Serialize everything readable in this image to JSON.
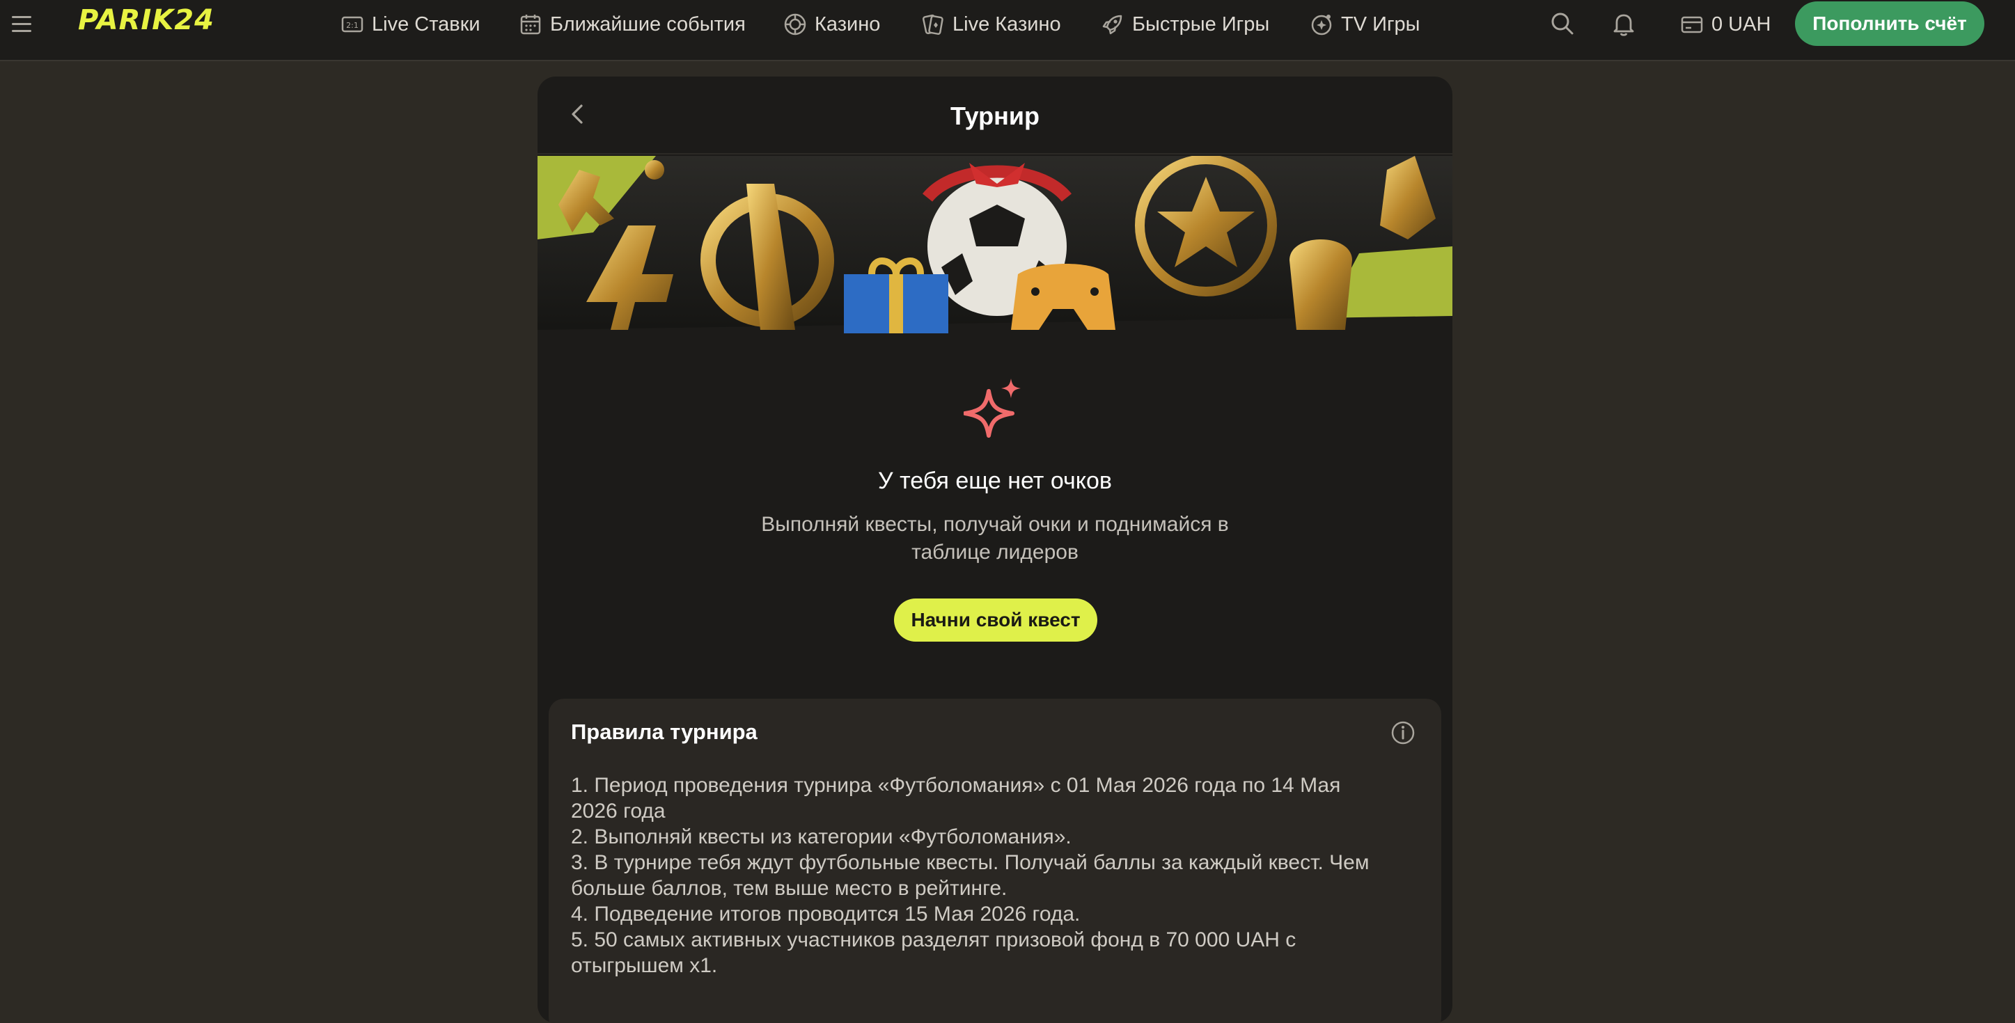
{
  "header": {
    "logo": "PARIK24",
    "nav": [
      {
        "label": "Live Ставки",
        "icon": "live-bets-icon"
      },
      {
        "label": "Ближайшие события",
        "icon": "calendar-icon"
      },
      {
        "label": "Казино",
        "icon": "casino-chip-icon"
      },
      {
        "label": "Live Казино",
        "icon": "cards-icon"
      },
      {
        "label": "Быстрые Игры",
        "icon": "rocket-icon"
      },
      {
        "label": "TV Игры",
        "icon": "tv-games-icon"
      }
    ],
    "balance": "0 UAH",
    "deposit_label": "Пополнить счёт"
  },
  "card": {
    "title": "Турнир",
    "empty_state": {
      "heading": "У тебя еще нет очков",
      "subtitle": "Выполняй квесты, получай очки и поднимайся в таблице лидеров",
      "button": "Начни свой квест"
    },
    "rules": {
      "title": "Правила турнира",
      "items": [
        "1. Период проведения турнира «Футболомания» с 01 Мая 2026 года по 14 Мая 2026 года",
        "2. Выполняй квесты из категории «Футболомания».",
        "3. В турнире тебя ждут футбольные квесты. Получай баллы за каждый квест. Чем больше баллов, тем выше место в рейтинге.",
        "4. Подведение итогов проводится 15 Мая 2026 года.",
        "5. 50 самых активных участников разделят призовой фонд в 70 000 UAH с отыгрышем х1."
      ]
    }
  },
  "colors": {
    "accent_yellow": "#dff04a",
    "deposit_green": "#3c9a5f",
    "sparkle_red": "#f06b6b",
    "page_bg": "#2d2a24",
    "card_bg": "#1c1b19"
  }
}
